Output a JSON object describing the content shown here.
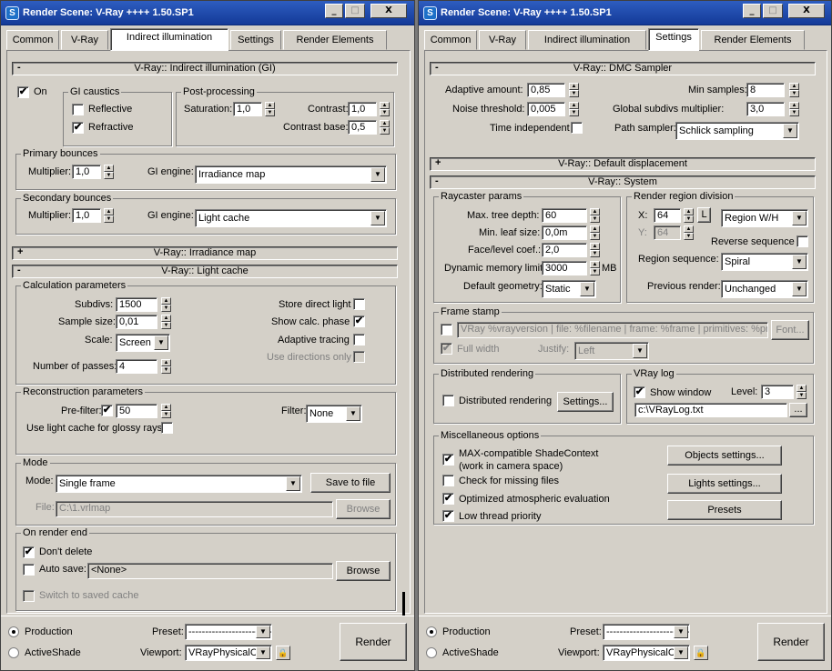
{
  "left": {
    "title": "Render Scene: V-Ray ++++ 1.50.SP1",
    "tabs": [
      "Common",
      "V-Ray",
      "Indirect illumination",
      "Settings",
      "Render Elements"
    ],
    "gi": {
      "header": "V-Ray:: Indirect illumination (GI)",
      "collapse_sym": "-",
      "on_label": "On",
      "caustics_title": "GI caustics",
      "reflective": "Reflective",
      "refractive": "Refractive",
      "post_title": "Post-processing",
      "saturation_label": "Saturation:",
      "saturation": "1,0",
      "contrast_label": "Contrast:",
      "contrast": "1,0",
      "contrast_base_label": "Contrast base:",
      "contrast_base": "0,5",
      "primary_title": "Primary bounces",
      "primary_mult_label": "Multiplier:",
      "primary_mult": "1,0",
      "primary_engine_label": "GI engine:",
      "primary_engine": "Irradiance map",
      "secondary_title": "Secondary bounces",
      "secondary_mult_label": "Multiplier:",
      "secondary_mult": "1,0",
      "secondary_engine_label": "GI engine:",
      "secondary_engine": "Light cache"
    },
    "irr": {
      "header": "V-Ray:: Irradiance map",
      "sym": "+"
    },
    "lc": {
      "header": "V-Ray:: Light cache",
      "sym": "-",
      "calc_title": "Calculation parameters",
      "subdivs_label": "Subdivs:",
      "subdivs": "1500",
      "sample_size_label": "Sample size:",
      "sample_size": "0,01",
      "scale_label": "Scale:",
      "scale": "Screen",
      "passes_label": "Number of passes:",
      "passes": "4",
      "store_direct": "Store direct light",
      "show_calc": "Show calc. phase",
      "adaptive": "Adaptive tracing",
      "use_dirs": "Use directions only",
      "recon_title": "Reconstruction parameters",
      "prefilter_label": "Pre-filter:",
      "prefilter": "50",
      "filter_label": "Filter:",
      "filter": "None",
      "glossy_label": "Use light cache for glossy rays",
      "mode_title": "Mode",
      "mode_label": "Mode:",
      "mode": "Single frame",
      "save_btn": "Save to file",
      "file_label": "File:",
      "file": "C:\\1.vrlmap",
      "browse": "Browse",
      "ore_title": "On render end",
      "dont_delete": "Don't delete",
      "auto_save": "Auto save:",
      "auto_save_value": "<None>",
      "browse2": "Browse",
      "switch": "Switch to saved cache"
    },
    "bottom": {
      "production": "Production",
      "activeshade": "ActiveShade",
      "preset_label": "Preset:",
      "preset": "-------------------------",
      "viewport_label": "Viewport:",
      "viewport": "VRayPhysicalC",
      "render": "Render"
    }
  },
  "right": {
    "title": "Render Scene: V-Ray ++++ 1.50.SP1",
    "tabs": [
      "Common",
      "V-Ray",
      "Indirect illumination",
      "Settings",
      "Render Elements"
    ],
    "dmc": {
      "header": "V-Ray:: DMC Sampler",
      "sym": "-",
      "adaptive_label": "Adaptive amount:",
      "adaptive": "0,85",
      "noise_label": "Noise threshold:",
      "noise": "0,005",
      "time_label": "Time independent",
      "min_samples_label": "Min samples:",
      "min_samples": "8",
      "global_label": "Global subdivs multiplier:",
      "global": "3,0",
      "path_label": "Path sampler:",
      "path": "Schlick sampling"
    },
    "disp": {
      "header": "V-Ray:: Default displacement",
      "sym": "+"
    },
    "sys": {
      "header": "V-Ray:: System",
      "sym": "-",
      "ray_title": "Raycaster params",
      "max_tree_label": "Max. tree depth:",
      "max_tree": "60",
      "min_leaf_label": "Min. leaf size:",
      "min_leaf": "0,0m",
      "face_label": "Face/level coef.:",
      "face": "2,0",
      "mem_label": "Dynamic memory limit:",
      "mem": "3000",
      "mem_unit": "MB",
      "geom_label": "Default geometry:",
      "geom": "Static",
      "region_title": "Render region division",
      "x_label": "X:",
      "x": "64",
      "y_label": "Y:",
      "y": "64",
      "l_btn": "L",
      "region_wh": "Region W/H",
      "reverse": "Reverse sequence",
      "seq_label": "Region sequence:",
      "seq": "Spiral",
      "prev_label": "Previous render:",
      "prev": "Unchanged",
      "stamp_title": "Frame stamp",
      "stamp_text": "VRay %vrayversion | file: %filename | frame: %frame | primitives: %primitiv",
      "font_btn": "Font...",
      "full_width": "Full width",
      "justify_label": "Justify:",
      "justify": "Left",
      "dist_title": "Distributed rendering",
      "dist_label": "Distributed rendering",
      "dist_settings": "Settings...",
      "log_title": "VRay log",
      "show_window": "Show window",
      "level_label": "Level:",
      "level": "3",
      "log_file": "c:\\VRayLog.txt",
      "log_browse": "...",
      "misc_title": "Miscellaneous options",
      "maxcompat1": "MAX-compatible ShadeContext",
      "maxcompat2": "(work in camera space)",
      "check_missing": "Check for missing files",
      "optimized": "Optimized atmospheric evaluation",
      "low_thread": "Low thread priority",
      "objects_btn": "Objects settings...",
      "lights_btn": "Lights settings...",
      "presets_btn": "Presets"
    },
    "bottom": {
      "production": "Production",
      "activeshade": "ActiveShade",
      "preset_label": "Preset:",
      "preset": "-------------------------",
      "viewport_label": "Viewport:",
      "viewport": "VRayPhysicalC",
      "render": "Render"
    }
  },
  "icons": {
    "app": "S",
    "minimize": "_",
    "maximize": "□",
    "close": "X",
    "check": "✔",
    "dropdown": "▼",
    "up": "▲",
    "down": "▼",
    "lock": "🔒"
  }
}
